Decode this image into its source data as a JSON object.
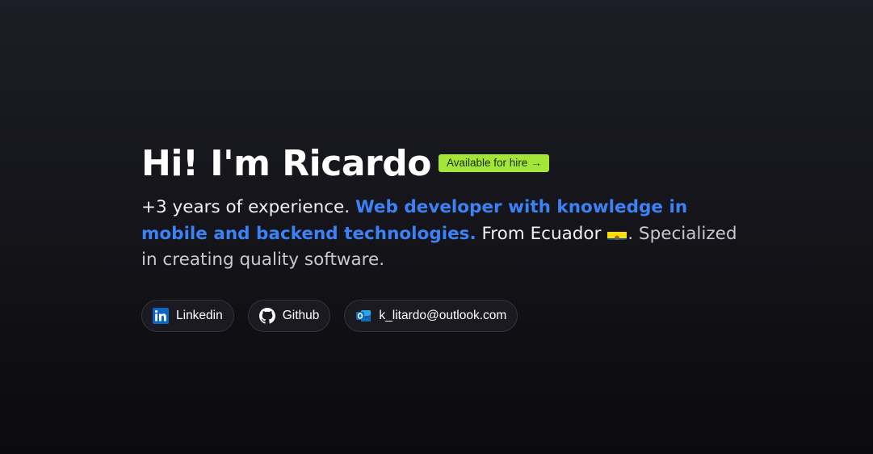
{
  "hero": {
    "title": "Hi! I'm Ricardo",
    "badge": {
      "label": "Available for hire",
      "arrow": "→",
      "color": "#a3e635"
    },
    "intro": {
      "lead": "+3 years of experience.",
      "highlight": "Web developer with knowledge in mobile and backend technologies.",
      "origin": "From Ecuador",
      "flag": "ecuador-flag-icon",
      "rest": ". Specialized in creating quality software."
    }
  },
  "links": [
    {
      "label": "Linkedin",
      "icon": "linkedin-icon",
      "color": "#0a66c2"
    },
    {
      "label": "Github",
      "icon": "github-icon",
      "color": "#ffffff"
    },
    {
      "label": "k_litardo@outlook.com",
      "icon": "outlook-icon",
      "color": "#0f6cbd"
    }
  ],
  "colors": {
    "accent_blue": "#3b82f6",
    "badge_green": "#a3e635"
  }
}
